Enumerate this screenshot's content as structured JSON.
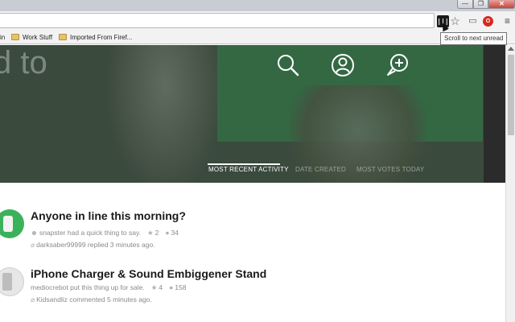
{
  "window": {
    "minimize_glyph": "—",
    "maximize_glyph": "❐",
    "close_glyph": "✕"
  },
  "toolbar": {
    "scroll_ext_glyph": "|||",
    "star_glyph": "☆",
    "cast_glyph": "▭",
    "adblock_glyph": "O",
    "menu_glyph": "≡",
    "tooltip": "Scroll to next unread"
  },
  "bookmarks": {
    "partial_item": "in",
    "items": [
      {
        "label": "Work Stuff",
        "icon": "folder-icon"
      },
      {
        "label": "Imported From Firef...",
        "icon": "folder-icon"
      }
    ]
  },
  "hero": {
    "title_fragment": "d to",
    "tabs": [
      {
        "label": "MOST RECENT ACTIVITY",
        "active": true
      },
      {
        "label": "DATE CREATED",
        "active": false
      },
      {
        "label": "MOST VOTES TODAY",
        "active": false
      }
    ],
    "icons": [
      "search-icon",
      "profile-icon",
      "new-post-icon"
    ]
  },
  "feed": [
    {
      "title": "Anyone in line this morning?",
      "line1": "snapster had a quick thing to say.",
      "votes": "2",
      "comments": "34",
      "line2": "darksaber99999 replied 3 minutes ago."
    },
    {
      "title": "iPhone Charger & Sound Embiggener Stand",
      "line1": "mediocrebot put this thing up for sale.",
      "votes": "4",
      "comments": "158",
      "line2": "Kidsandliz commented 5 minutes ago."
    }
  ]
}
